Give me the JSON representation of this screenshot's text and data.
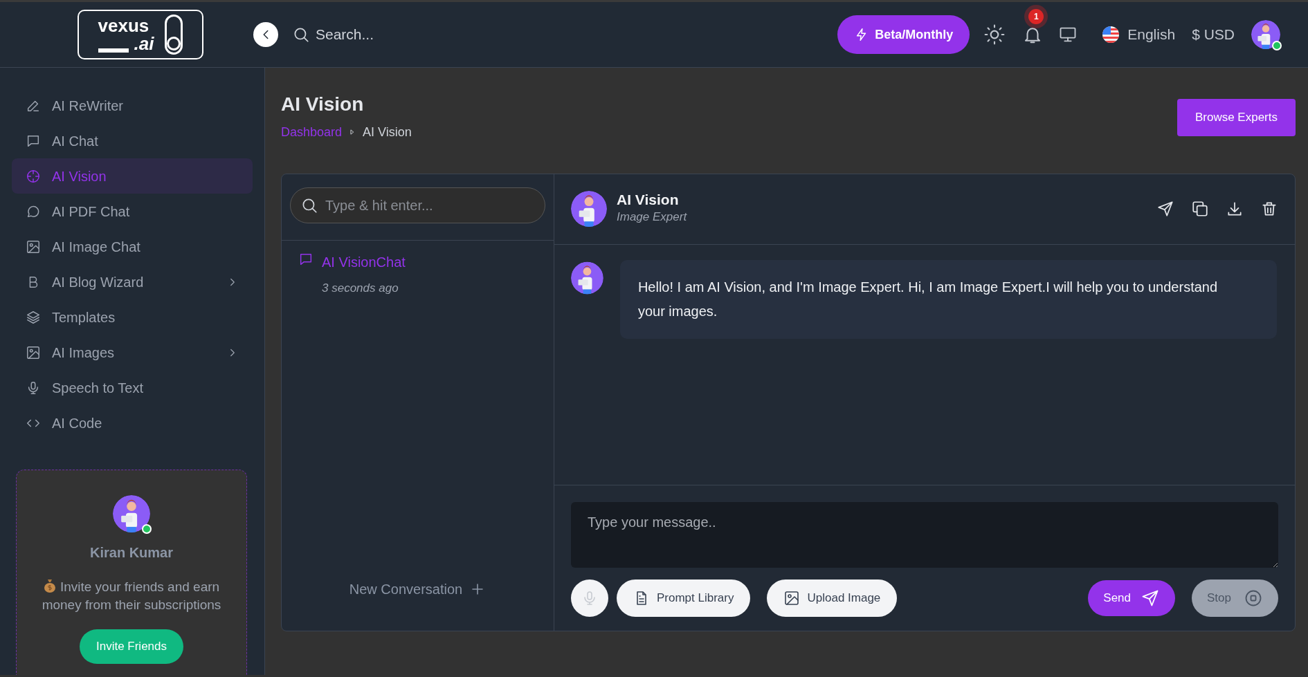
{
  "header": {
    "logo": {
      "word": "vexus",
      "suffix": ".ai"
    },
    "search_placeholder": "Search...",
    "plan_button": "Beta/Monthly",
    "notification_count": "1",
    "language": "English",
    "currency": "$ USD",
    "user_online": true
  },
  "sidebar": {
    "items": [
      {
        "label": "AI ReWriter",
        "has_submenu": false,
        "selected": false
      },
      {
        "label": "AI Chat",
        "has_submenu": false,
        "selected": false
      },
      {
        "label": "AI Vision",
        "has_submenu": false,
        "selected": true
      },
      {
        "label": "AI PDF Chat",
        "has_submenu": false,
        "selected": false
      },
      {
        "label": "AI Image Chat",
        "has_submenu": false,
        "selected": false
      },
      {
        "label": "AI Blog Wizard",
        "has_submenu": true,
        "selected": false
      },
      {
        "label": "Templates",
        "has_submenu": false,
        "selected": false
      },
      {
        "label": "AI Images",
        "has_submenu": true,
        "selected": false
      },
      {
        "label": "Speech to Text",
        "has_submenu": false,
        "selected": false
      },
      {
        "label": "AI Code",
        "has_submenu": false,
        "selected": false
      }
    ],
    "invite_card": {
      "name": "Kiran Kumar",
      "online": true,
      "message": "Invite your friends and earn money from their subscriptions",
      "button": "Invite Friends"
    }
  },
  "page": {
    "title": "AI Vision",
    "breadcrumb": [
      "Dashboard",
      "AI Vision"
    ],
    "browse_button": "Browse Experts"
  },
  "conversations": {
    "search_placeholder": "Type & hit enter...",
    "items": [
      {
        "title": "AI VisionChat",
        "time": "3 seconds ago",
        "selected": true
      }
    ],
    "new_button": "New Conversation"
  },
  "chat": {
    "bot_name": "AI Vision",
    "bot_role": "Image Expert",
    "messages": [
      {
        "text": "Hello! I am AI Vision, and I'm Image Expert. Hi, I am Image Expert.I will help you to understand your images."
      }
    ],
    "input_placeholder": "Type your message..",
    "mic_disabled": true,
    "prompt_button": "Prompt Library",
    "upload_button": "Upload Image",
    "send_button": "Send",
    "stop_button": "Stop",
    "stop_disabled": true
  }
}
